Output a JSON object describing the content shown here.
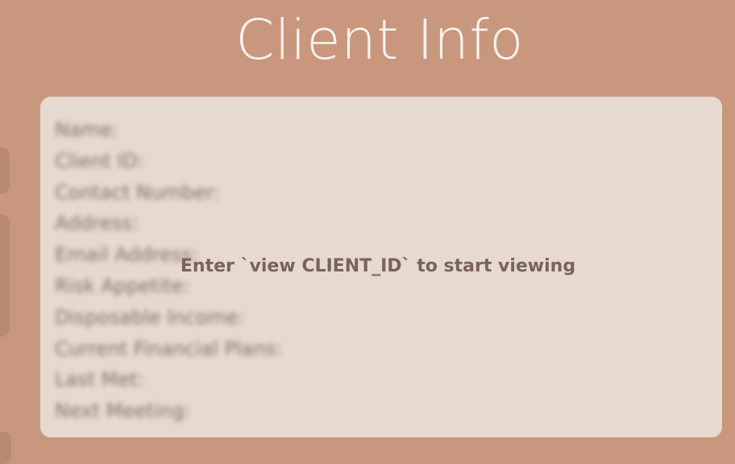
{
  "page": {
    "title": "Client Info"
  },
  "panel": {
    "fields": [
      {
        "label": "Name:"
      },
      {
        "label": "Client ID:"
      },
      {
        "label": "Contact Number:"
      },
      {
        "label": "Address:"
      },
      {
        "label": "Email Address:"
      },
      {
        "label": "Risk Appetite:"
      },
      {
        "label": "Disposable Income:"
      },
      {
        "label": "Current Financial Plans:"
      },
      {
        "label": "Last Met:"
      },
      {
        "label": "Next Meeting:"
      }
    ],
    "message": "Enter `view CLIENT_ID` to start viewing"
  },
  "colors": {
    "background": "#c9977e",
    "panel": "#e6d9d0",
    "title": "#fbf3ee",
    "message": "#7a6457"
  }
}
